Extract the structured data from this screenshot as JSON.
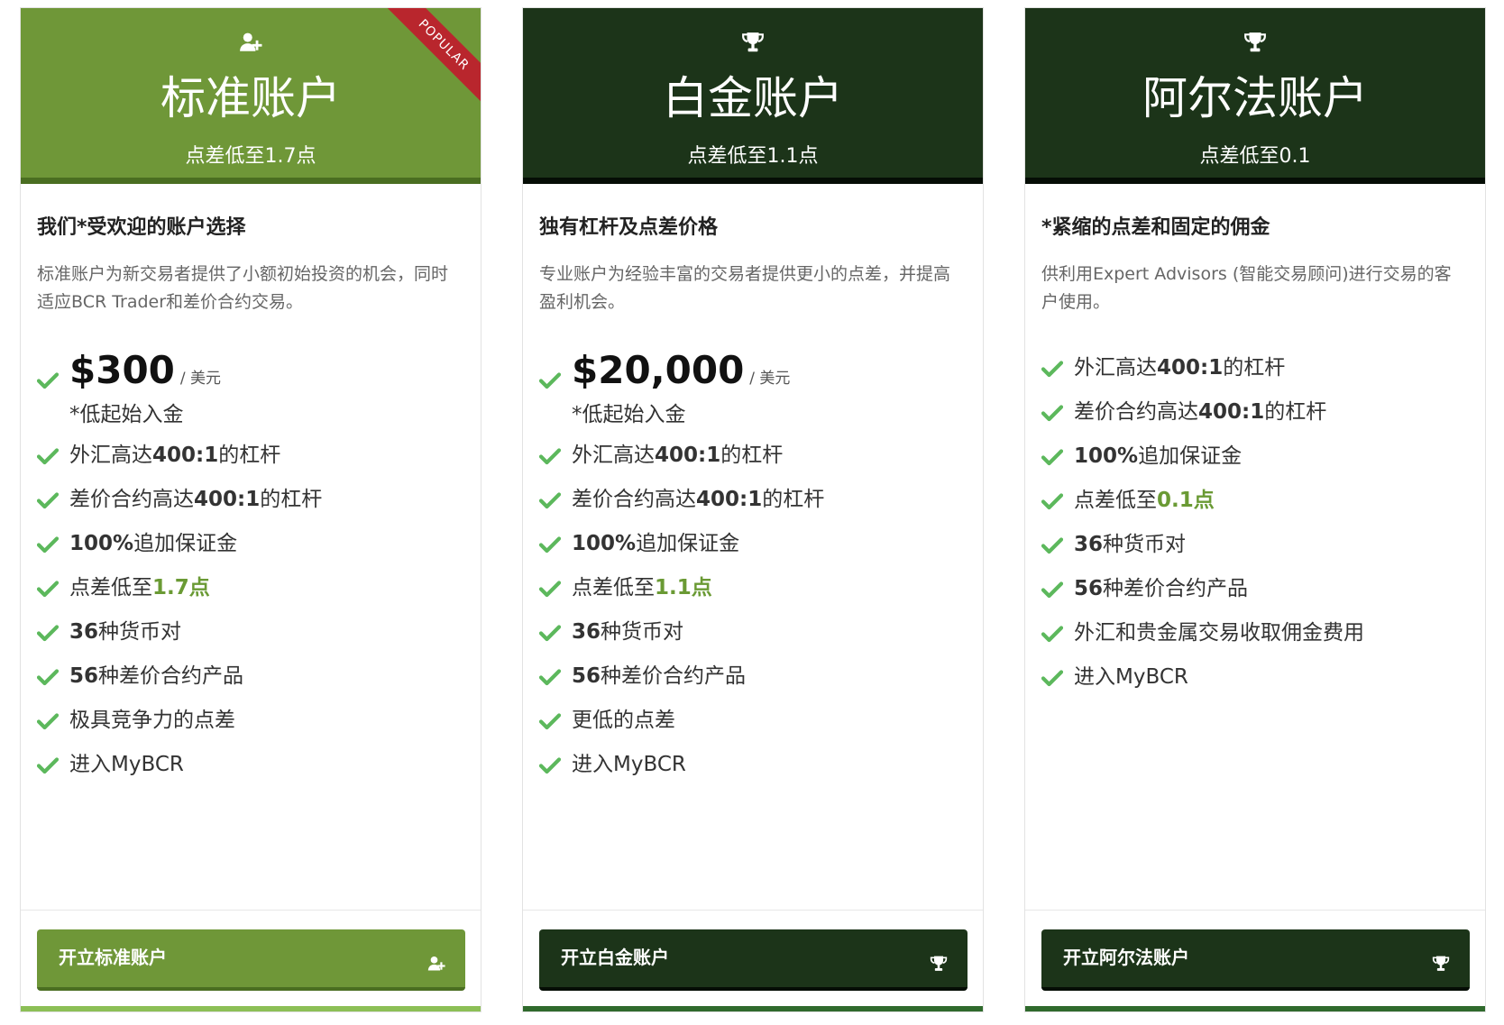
{
  "colors": {
    "standard": "#6f9738",
    "standard_border": "#4a6e21",
    "dark": "#1c3419",
    "dark_border": "#050d05",
    "check": "#5cb85c",
    "highlight": "#6a9a34",
    "ribbon": "#b9262d"
  },
  "cards": [
    {
      "icon": "user-plus-icon",
      "ribbon": "POPULAR",
      "title": "标准账户",
      "subtitle": "点差低至1.7点",
      "tagline": "我们*受欢迎的账户选择",
      "description": "标准账户为新交易者提供了小额初始投资的机会，同时适应BCR Trader和差价合约交易。",
      "price": {
        "amount": "$300",
        "unit": "/ 美元",
        "note": "*低起始入金"
      },
      "features": [
        [
          {
            "t": "外汇高达"
          },
          {
            "t": "400:1",
            "b": true
          },
          {
            "t": "的杠杆"
          }
        ],
        [
          {
            "t": "差价合约高达"
          },
          {
            "t": "400:1",
            "b": true
          },
          {
            "t": "的杠杆"
          }
        ],
        [
          {
            "t": "100%",
            "b": true
          },
          {
            "t": "追加保证金"
          }
        ],
        [
          {
            "t": "点差低至"
          },
          {
            "t": "1.7点",
            "hl": true
          }
        ],
        [
          {
            "t": "36",
            "b": true
          },
          {
            "t": "种货币对"
          }
        ],
        [
          {
            "t": "56",
            "b": true
          },
          {
            "t": "种差价合约产品"
          }
        ],
        [
          {
            "t": "极具竞争力的点差"
          }
        ],
        [
          {
            "t": "进入MyBCR"
          }
        ]
      ],
      "cta": "开立标准账户"
    },
    {
      "icon": "trophy-icon",
      "title": "白金账户",
      "subtitle": "点差低至1.1点",
      "tagline": "独有杠杆及点差价格",
      "description": "专业账户为经验丰富的交易者提供更小的点差，并提高盈利机会。",
      "price": {
        "amount": "$20,000",
        "unit": "/ 美元",
        "note": "*低起始入金"
      },
      "features": [
        [
          {
            "t": "外汇高达"
          },
          {
            "t": "400:1",
            "b": true
          },
          {
            "t": "的杠杆"
          }
        ],
        [
          {
            "t": "差价合约高达"
          },
          {
            "t": "400:1",
            "b": true
          },
          {
            "t": "的杠杆"
          }
        ],
        [
          {
            "t": "100%",
            "b": true
          },
          {
            "t": "追加保证金"
          }
        ],
        [
          {
            "t": "点差低至"
          },
          {
            "t": "1.1点",
            "hl": true
          }
        ],
        [
          {
            "t": "36",
            "b": true
          },
          {
            "t": "种货币对"
          }
        ],
        [
          {
            "t": "56",
            "b": true
          },
          {
            "t": "种差价合约产品"
          }
        ],
        [
          {
            "t": "更低的点差"
          }
        ],
        [
          {
            "t": "进入MyBCR"
          }
        ]
      ],
      "cta": "开立白金账户"
    },
    {
      "icon": "trophy-icon",
      "title": "阿尔法账户",
      "subtitle": "点差低至0.1",
      "tagline": "*紧缩的点差和固定的佣金",
      "description": "供利用Expert Advisors (智能交易顾问)进行交易的客户使用。",
      "features": [
        [
          {
            "t": "外汇高达"
          },
          {
            "t": "400:1",
            "b": true
          },
          {
            "t": "的杠杆"
          }
        ],
        [
          {
            "t": "差价合约高达"
          },
          {
            "t": "400:1",
            "b": true
          },
          {
            "t": "的杠杆"
          }
        ],
        [
          {
            "t": "100%",
            "b": true
          },
          {
            "t": "追加保证金"
          }
        ],
        [
          {
            "t": "点差低至"
          },
          {
            "t": "0.1点",
            "hl": true
          }
        ],
        [
          {
            "t": "36",
            "b": true
          },
          {
            "t": "种货币对"
          }
        ],
        [
          {
            "t": "56",
            "b": true
          },
          {
            "t": "种差价合约产品"
          }
        ],
        [
          {
            "t": "外汇和贵金属交易收取佣金费用"
          }
        ],
        [
          {
            "t": "进入MyBCR"
          }
        ]
      ],
      "cta": "开立阿尔法账户"
    }
  ]
}
